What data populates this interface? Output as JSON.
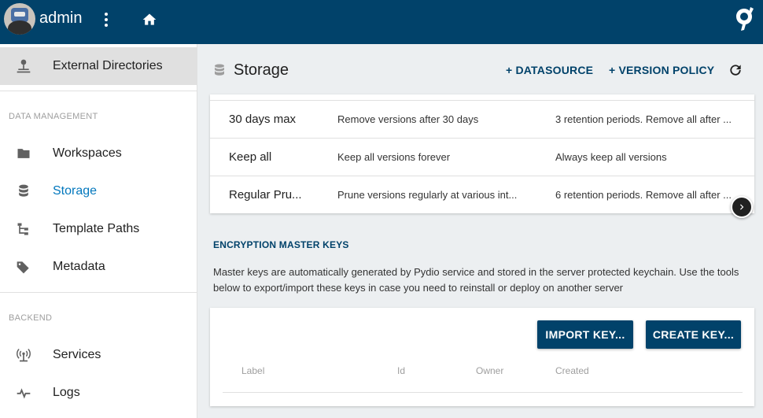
{
  "topbar": {
    "username": "admin",
    "menu_icon": "more-vert-icon",
    "home_icon": "home-icon",
    "logo_icon": "pydio-logo-icon",
    "color": "#01426a"
  },
  "sidebar": {
    "top_item": {
      "label": "External Directories",
      "icon": "directory-icon"
    },
    "sections": [
      {
        "header": "DATA MANAGEMENT",
        "items": [
          {
            "label": "Workspaces",
            "icon": "folder-icon"
          },
          {
            "label": "Storage",
            "icon": "database-icon",
            "active": true
          },
          {
            "label": "Template Paths",
            "icon": "file-tree-icon"
          },
          {
            "label": "Metadata",
            "icon": "tags-icon"
          }
        ]
      },
      {
        "header": "BACKEND",
        "items": [
          {
            "label": "Services",
            "icon": "access-point-icon"
          },
          {
            "label": "Logs",
            "icon": "pulse-icon"
          }
        ]
      }
    ],
    "active_color": "#0277bd"
  },
  "header": {
    "title": "Storage",
    "buttons": {
      "datasource": "+ DATASOURCE",
      "version_policy": "+ VERSION POLICY"
    },
    "refresh_icon": "refresh-icon"
  },
  "policies": {
    "rows": [
      {
        "name": "30 days max",
        "description": "Remove versions after 30 days",
        "retention": "3 retention periods. Remove all after ..."
      },
      {
        "name": "Keep all",
        "description": "Keep all versions forever",
        "retention": "Always keep all versions"
      },
      {
        "name": "Regular Pru...",
        "description": "Prune versions regularly at various int...",
        "retention": "6 retention periods. Remove all after ..."
      }
    ],
    "scroll_icon": "chevron-right-icon"
  },
  "encryption": {
    "title": "ENCRYPTION MASTER KEYS",
    "description": "Master keys are automatically generated by Pydio service and stored in the server protected keychain. Use the tools below to export/import these keys in case you need to reinstall or deploy on another server",
    "buttons": {
      "import": "IMPORT KEY...",
      "create": "CREATE KEY..."
    },
    "columns": [
      "Label",
      "Id",
      "Owner",
      "Created"
    ]
  }
}
